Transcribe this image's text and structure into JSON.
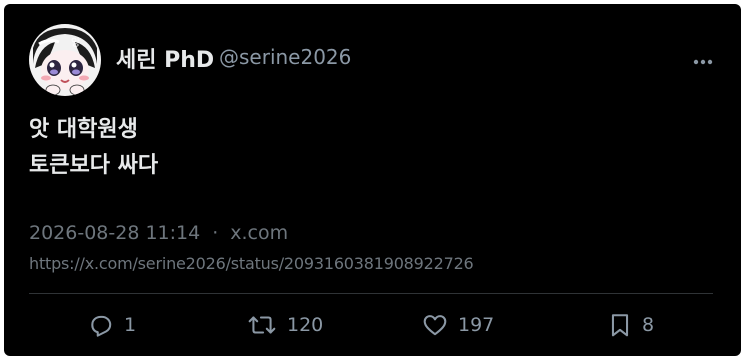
{
  "user": {
    "display_name": "세린 PhD",
    "handle": "@serine2026"
  },
  "tweet": {
    "lines": [
      "앗 대학원생",
      "토큰보다 싸다"
    ],
    "timestamp": "2026-08-28 11:14",
    "separator": "·",
    "source": "x.com",
    "url": "https://x.com/serine2026/status/2093160381908922726"
  },
  "actions": {
    "replies": "1",
    "retweets": "120",
    "likes": "197",
    "bookmarks": "8"
  },
  "icons": {
    "more": "more-horizontal-icon",
    "reply": "reply-icon",
    "retweet": "retweet-icon",
    "like": "heart-icon",
    "bookmark": "bookmark-icon"
  },
  "colors": {
    "background": "#000000",
    "text_primary": "#e7e9ea",
    "text_secondary": "#6e767d"
  }
}
